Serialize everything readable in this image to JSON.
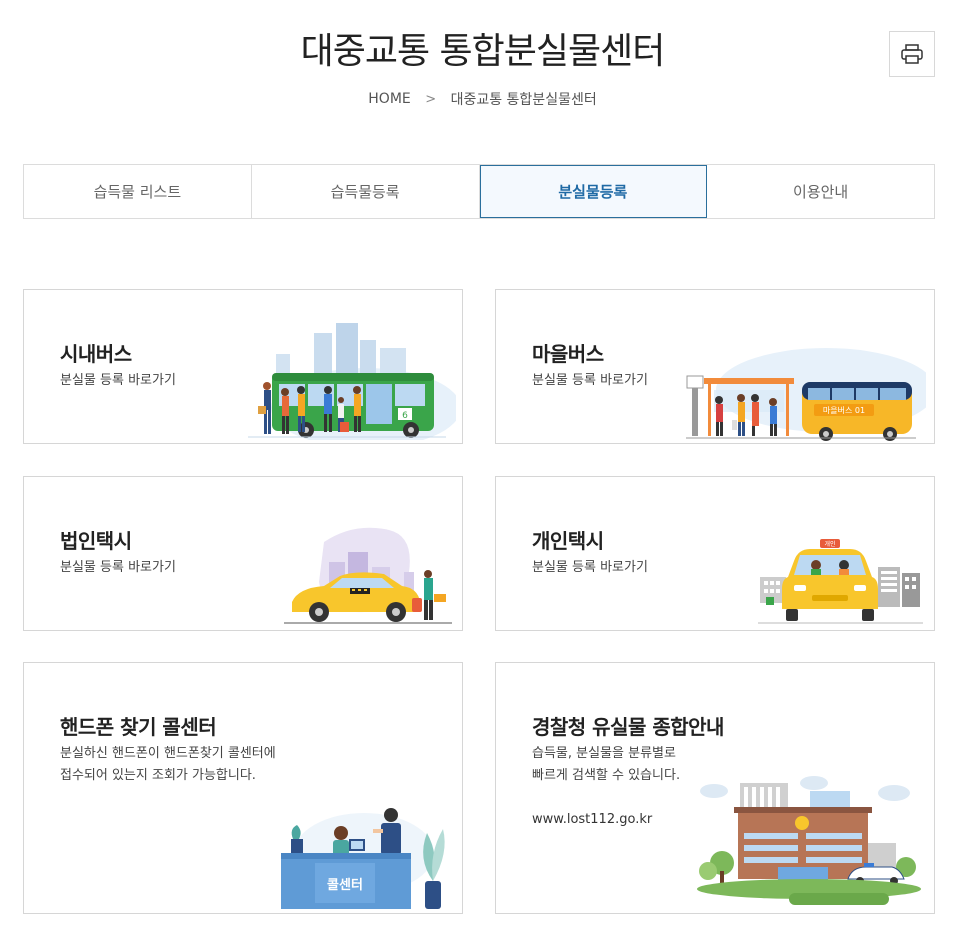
{
  "header": {
    "title": "대중교통 통합분실물센터",
    "print_icon": "printer-icon"
  },
  "breadcrumb": {
    "home": "HOME",
    "separator": ">",
    "current": "대중교통 통합분실물센터"
  },
  "tabs": [
    {
      "label": "습득물 리스트",
      "active": false
    },
    {
      "label": "습득물등록",
      "active": false
    },
    {
      "label": "분실물등록",
      "active": true
    },
    {
      "label": "이용안내",
      "active": false
    }
  ],
  "cards": [
    {
      "title": "시내버스",
      "sub": "분실물 등록 바로가기",
      "bus_number": "6"
    },
    {
      "title": "마을버스",
      "sub": "분실물 등록 바로가기",
      "bus_label": "마을버스 01"
    },
    {
      "title": "법인택시",
      "sub": "분실물 등록 바로가기"
    },
    {
      "title": "개인택시",
      "sub": "분실물 등록 바로가기",
      "roof_sign": "개인"
    },
    {
      "title": "핸드폰 찾기 콜센터",
      "sub_lines": [
        "분실하신 핸드폰이 핸드폰찾기 콜센터에",
        "접수되어 있는지 조회가 가능합니다."
      ],
      "desk_label": "콜센터"
    },
    {
      "title": "경찰청 유실물 종합안내",
      "sub_lines": [
        "습득물, 분실물을 분류별로",
        "빠르게 검색할 수 있습니다."
      ],
      "url": "www.lost112.go.kr"
    }
  ],
  "colors": {
    "active_tab_text": "#1f6aa5",
    "active_tab_border": "#2a6f9c",
    "bus_green": "#3aa54a",
    "bus_yellow": "#f7b728",
    "taxi_yellow": "#f8c62c"
  }
}
